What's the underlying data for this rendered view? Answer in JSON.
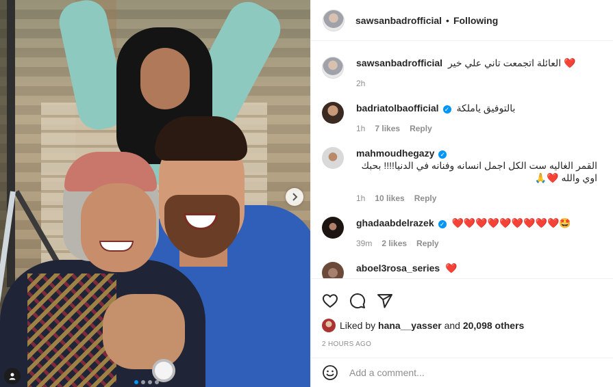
{
  "post": {
    "owner": "sawsanbadrofficial",
    "follow_status": "Following",
    "dot": "•",
    "caption": "العائلة اتجمعت تاني علي خير",
    "caption_emoji": "❤️",
    "caption_time": "2h",
    "carousel_dots": 4,
    "active_dot": 0
  },
  "comments": [
    {
      "user": "badriatolbaofficial",
      "verified": true,
      "text": "بالتوفيق ياملكة",
      "emoji": "",
      "time": "1h",
      "likes": "7 likes",
      "reply": "Reply"
    },
    {
      "user": "mahmoudhegazy",
      "verified": true,
      "text": "القمر الغاليه ست الكل اجمل انسانه وفنانه في الدنيا!!!! بحبك اوي والله",
      "emoji": "❤️🙏",
      "time": "1h",
      "likes": "10 likes",
      "reply": "Reply"
    },
    {
      "user": "ghadaabdelrazek",
      "verified": true,
      "text": "",
      "emoji": "❤️❤️❤️❤️❤️❤️❤️❤️❤️🤩",
      "time": "39m",
      "likes": "2 likes",
      "reply": "Reply"
    },
    {
      "user": "aboel3rosa_series",
      "verified": false,
      "text": "",
      "emoji": "❤️",
      "time": "",
      "likes": "",
      "reply": ""
    }
  ],
  "likes": {
    "prefix": "Liked by",
    "user": "hana__yasser",
    "middle": "and",
    "others": "20,098 others"
  },
  "timestamp": "2 HOURS AGO",
  "add_comment": {
    "placeholder": "Add a comment..."
  },
  "icons": {
    "like": "heart-icon",
    "comment": "comment-icon",
    "share": "share-icon",
    "emoji": "emoji-icon",
    "next": "chevron-right-icon",
    "tag": "user-tag-icon"
  },
  "colors": {
    "verified": "#0095f6",
    "link": "#0095f6",
    "muted": "#8e8e8e"
  }
}
